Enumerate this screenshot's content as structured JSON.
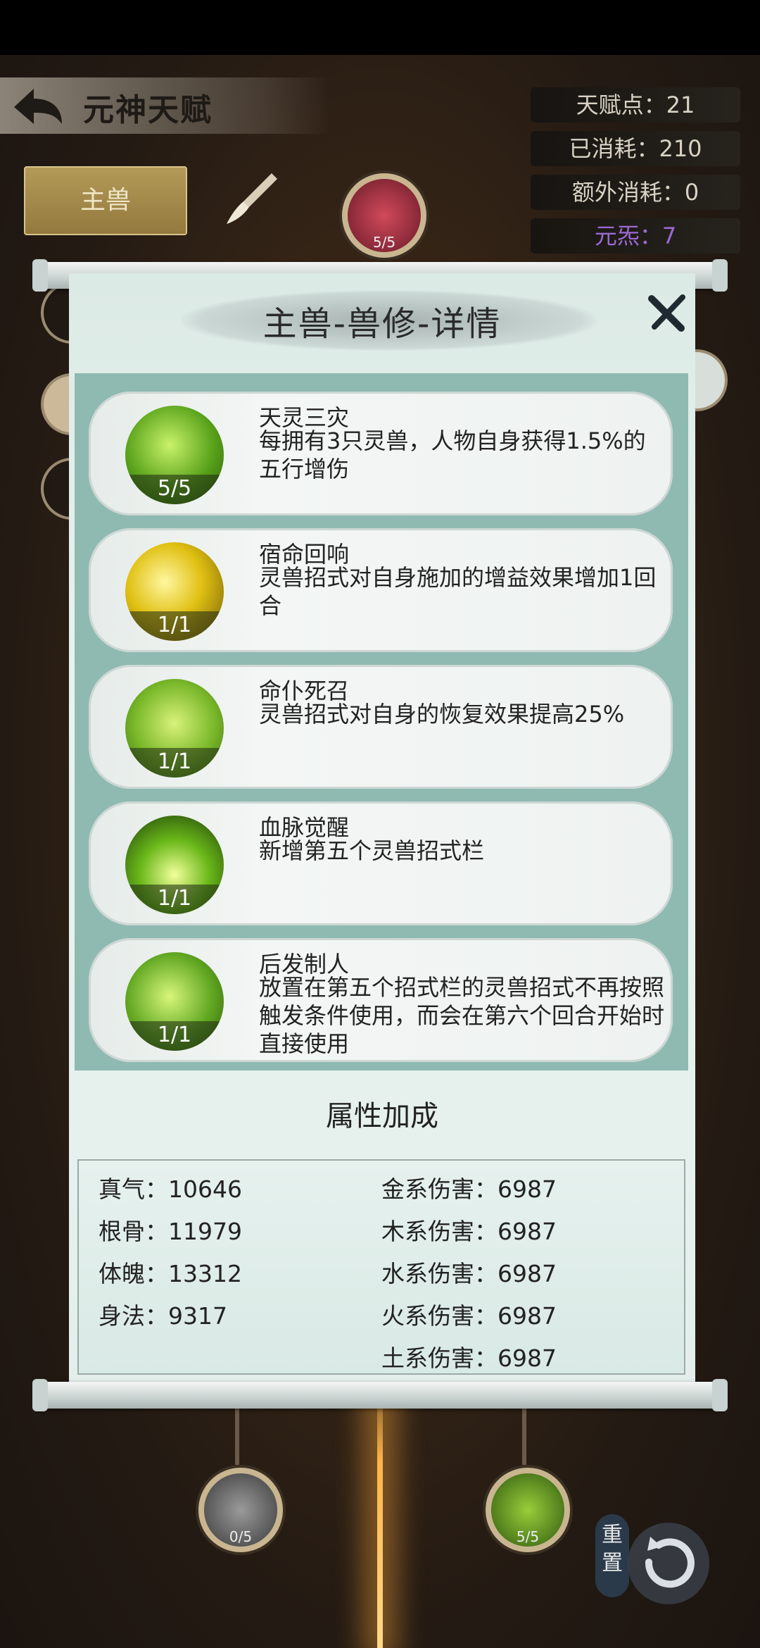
{
  "header": {
    "title": "元神天赋"
  },
  "stats": {
    "talent_points": "天赋点：21",
    "consumed": "已消耗：210",
    "extra_consumed": "额外消耗：0",
    "yuansu": "元炁：7"
  },
  "tab": {
    "label": "主兽"
  },
  "tree_nodes": {
    "top_node": "5/5",
    "bottom_left_node": "0/5",
    "bottom_right_node": "5/5"
  },
  "panel": {
    "title": "主兽-兽修-详情",
    "skills": [
      {
        "name": "天灵三灾",
        "desc": "每拥有3只灵兽，人物自身获得1.5%的五行增伤",
        "level": "5/5"
      },
      {
        "name": "宿命回响",
        "desc": "灵兽招式对自身施加的增益效果增加1回合",
        "level": "1/1"
      },
      {
        "name": "命仆死召",
        "desc": "灵兽招式对自身的恢复效果提高25%",
        "level": "1/1"
      },
      {
        "name": "血脉觉醒",
        "desc": "新增第五个灵兽招式栏",
        "level": "1/1"
      },
      {
        "name": "后发制人",
        "desc": "放置在第五个招式栏的灵兽招式不再按照触发条件使用，而会在第六个回合开始时直接使用",
        "level": "1/1"
      }
    ],
    "attributes_title": "属性加成",
    "attributes_left": [
      "真气：10646",
      "根骨：11979",
      "体魄：13312",
      "身法：9317"
    ],
    "attributes_right": [
      "金系伤害：6987",
      "木系伤害：6987",
      "水系伤害：6987",
      "火系伤害：6987",
      "土系伤害：6987"
    ]
  },
  "reset": {
    "label": "重置"
  },
  "colors": {
    "accent_gold": "#b39a58",
    "panel_bg": "#e9f3ef",
    "list_bg": "#8fbab2",
    "purple_text": "#9a6ad0"
  }
}
